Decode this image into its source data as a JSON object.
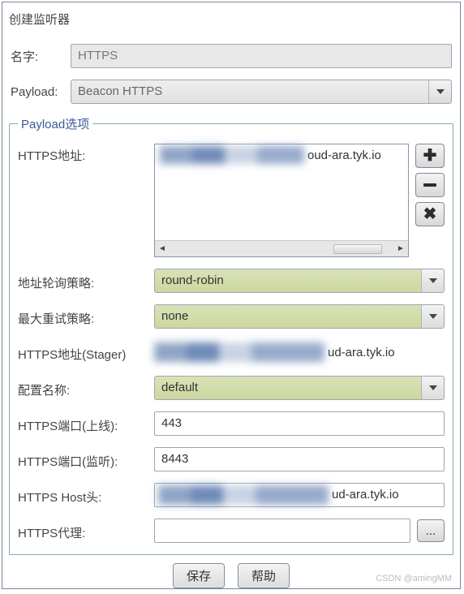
{
  "title": "创建监听器",
  "fields": {
    "name_label": "名字:",
    "name_value": "HTTPS",
    "payload_label": "Payload:",
    "payload_value": "Beacon HTTPS"
  },
  "group": {
    "legend": "Payload选项",
    "https_addr_label": "HTTPS地址:",
    "https_addr_list": [
      {
        "tail": "oud-ara.tyk.io"
      }
    ],
    "rotation_label": "地址轮询策略:",
    "rotation_value": "round-robin",
    "retry_label": "最大重试策略:",
    "retry_value": "none",
    "stager_label": "HTTPS地址(Stager)",
    "stager_tail": "ud-ara.tyk.io",
    "profile_label": "配置名称:",
    "profile_value": "default",
    "port_online_label": "HTTPS端口(上线):",
    "port_online_value": "443",
    "port_listen_label": "HTTPS端口(监听):",
    "port_listen_value": "8443",
    "host_header_label": "HTTPS Host头:",
    "host_header_tail": "ud-ara.tyk.io",
    "proxy_label": "HTTPS代理:",
    "proxy_value": "",
    "browse_btn": "..."
  },
  "buttons": {
    "save": "保存",
    "help": "帮助"
  },
  "watermark": "CSDN @amingMM"
}
